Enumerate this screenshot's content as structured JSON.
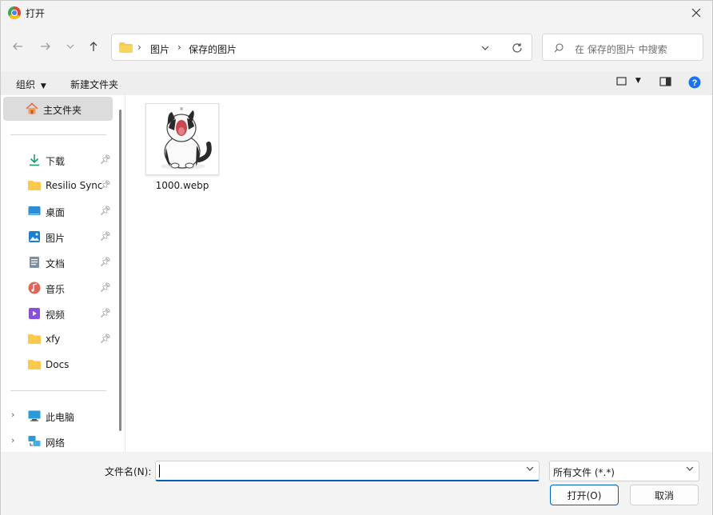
{
  "window": {
    "title": "打开"
  },
  "address": {
    "crumbs": [
      "图片",
      "保存的图片"
    ]
  },
  "search": {
    "placeholder": "在 保存的图片 中搜索"
  },
  "toolbar": {
    "organize": "组织",
    "new_folder": "新建文件夹"
  },
  "sidebar": {
    "home": "主文件夹",
    "quick": [
      {
        "label": "下载",
        "icon": "download-icon"
      },
      {
        "label": "Resilio Sync",
        "icon": "folder-icon"
      },
      {
        "label": "桌面",
        "icon": "desktop-icon"
      },
      {
        "label": "图片",
        "icon": "pictures-icon"
      },
      {
        "label": "文档",
        "icon": "documents-icon"
      },
      {
        "label": "音乐",
        "icon": "music-icon"
      },
      {
        "label": "视频",
        "icon": "videos-icon"
      },
      {
        "label": "xfy",
        "icon": "folder-icon"
      },
      {
        "label": "Docs",
        "icon": "folder-icon"
      }
    ],
    "this_pc": "此电脑",
    "network": "网络"
  },
  "files": [
    {
      "name": "1000.webp"
    }
  ],
  "footer": {
    "filename_label": "文件名(N):",
    "filename_value": "",
    "filetype_value": "所有文件 (*.*)",
    "open_label": "打开(O)",
    "cancel_label": "取消"
  },
  "colors": {
    "accent": "#005fb8",
    "folder": "#f8c94a"
  }
}
